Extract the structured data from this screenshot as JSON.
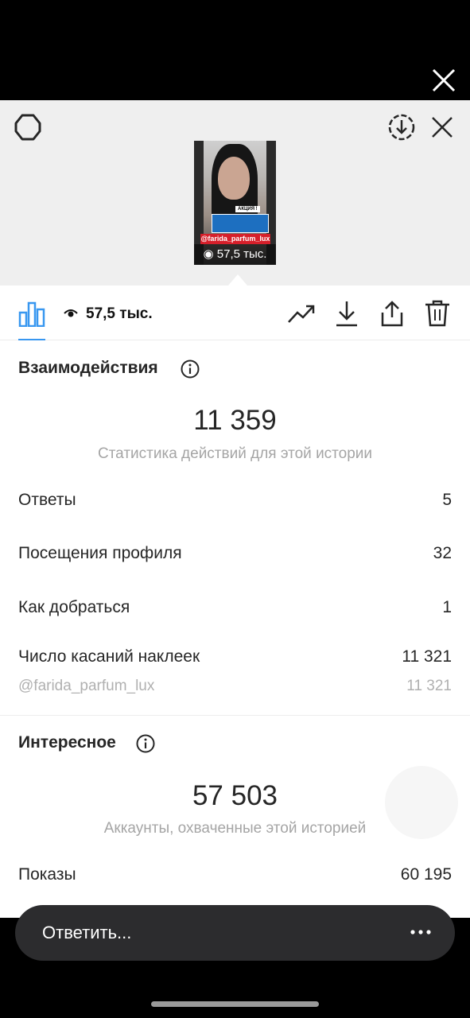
{
  "story_preview": {
    "badge_text": "АКЦИЯ !",
    "handle": "@farida_parfum_lux",
    "views": "57,5 тыс."
  },
  "toolbar": {
    "views": "57,5 тыс.",
    "icons": [
      "bar-chart-icon",
      "eye-icon",
      "trending-icon",
      "download-icon",
      "share-icon",
      "trash-icon"
    ]
  },
  "interactions": {
    "title": "Взаимодействия",
    "total": "11 359",
    "caption": "Статистика действий для этой истории",
    "rows": [
      {
        "label": "Ответы",
        "value": "5"
      },
      {
        "label": "Посещения профиля",
        "value": "32"
      },
      {
        "label": "Как добраться",
        "value": "1"
      },
      {
        "label": "Число касаний наклеек",
        "value": "11 321"
      },
      {
        "label": "@farida_parfum_lux",
        "value": "11 321"
      }
    ]
  },
  "discovery": {
    "title": "Интересное",
    "total": "57 503",
    "caption": "Аккаунты, охваченные этой историей",
    "rows": [
      {
        "label": "Показы",
        "value": "60 195"
      }
    ]
  },
  "reply_bar": {
    "placeholder": "Ответить..."
  },
  "colors": {
    "accent": "#3897f0",
    "text": "#262626",
    "muted": "#a5a5a5",
    "reply_bg": "#2c2c2e",
    "story_red": "#d61f2a",
    "story_blue": "#1d6fc0"
  }
}
